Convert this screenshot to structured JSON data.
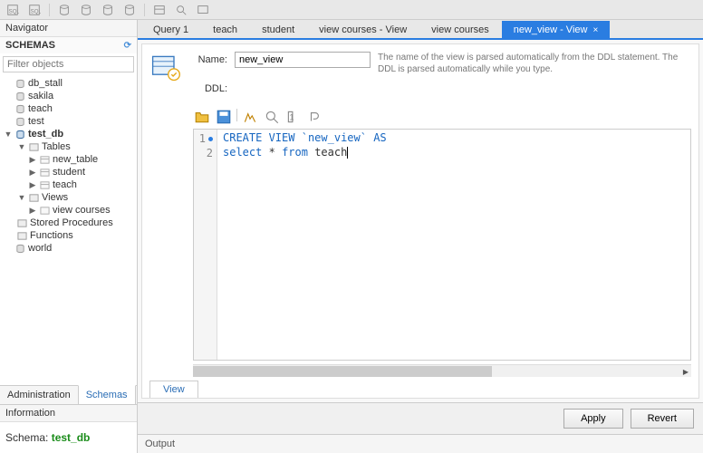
{
  "navigator_title": "Navigator",
  "schemas_title": "SCHEMAS",
  "filter_placeholder": "Filter objects",
  "tree": {
    "db_stall": "db_stall",
    "sakila": "sakila",
    "teach": "teach",
    "test": "test",
    "test_db": "test_db",
    "tables": "Tables",
    "new_table": "new_table",
    "student": "student",
    "teach_tbl": "teach",
    "views": "Views",
    "view_courses": "view courses",
    "stored_procs": "Stored Procedures",
    "functions": "Functions",
    "world": "world"
  },
  "left_tabs": {
    "admin": "Administration",
    "schemas": "Schemas"
  },
  "info_title": "Information",
  "schema_label": "Schema:",
  "schema_value": "test_db",
  "editor_tabs": [
    {
      "label": "Query 1"
    },
    {
      "label": "teach"
    },
    {
      "label": "student"
    },
    {
      "label": "view courses - View"
    },
    {
      "label": "view courses"
    },
    {
      "label": "new_view - View",
      "active": true
    }
  ],
  "name_label": "Name:",
  "name_value": "new_view",
  "name_hint": "The name of the view is parsed automatically from the DDL statement. The DDL is parsed automatically while you type.",
  "ddl_label": "DDL:",
  "code": {
    "l1": {
      "kw1": "CREATE VIEW",
      "str": "`new_view`",
      "kw2": "AS"
    },
    "l2": {
      "kw1": "select",
      "star": "*",
      "kw2": "from",
      "id": "teach"
    }
  },
  "bottom_tab": "View",
  "apply": "Apply",
  "revert": "Revert",
  "output": "Output"
}
